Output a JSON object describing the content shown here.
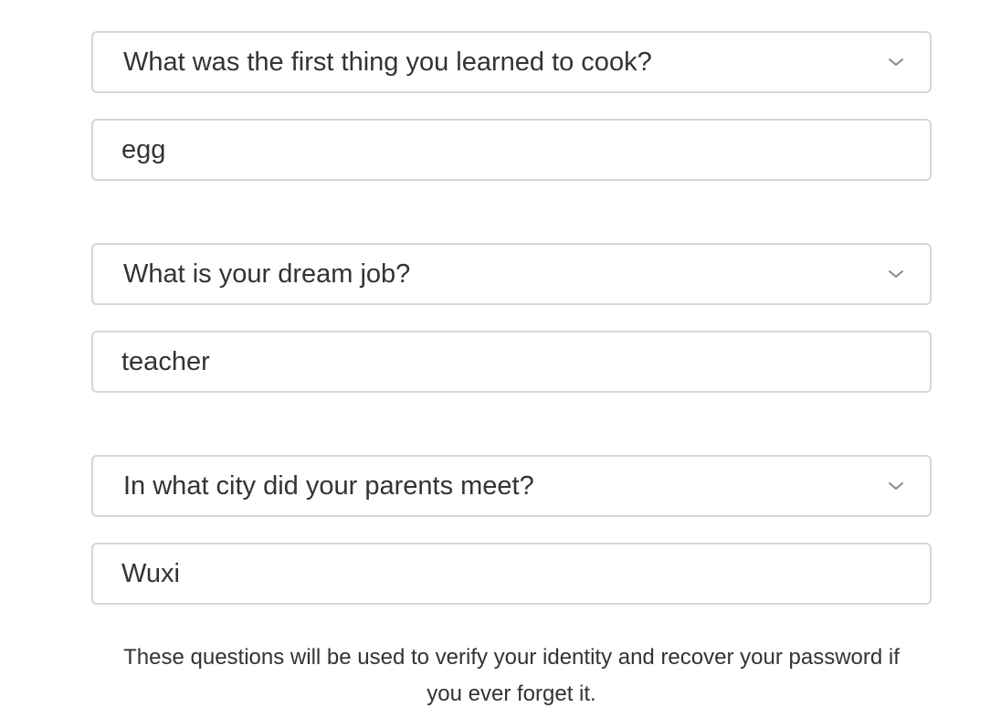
{
  "questions": [
    {
      "question": "What was the first thing you learned to cook?",
      "answer": "egg"
    },
    {
      "question": "What is your dream job?",
      "answer": "teacher"
    },
    {
      "question": "In what city did your parents meet?",
      "answer": "Wuxi"
    }
  ],
  "footnote": "These questions will be used to verify your identity and recover your password if you ever forget it.",
  "icons": {
    "dropdown": "chevron-down-icon"
  },
  "colors": {
    "border": "#d6d6d6",
    "text": "#333333",
    "chevron": "#888888"
  }
}
